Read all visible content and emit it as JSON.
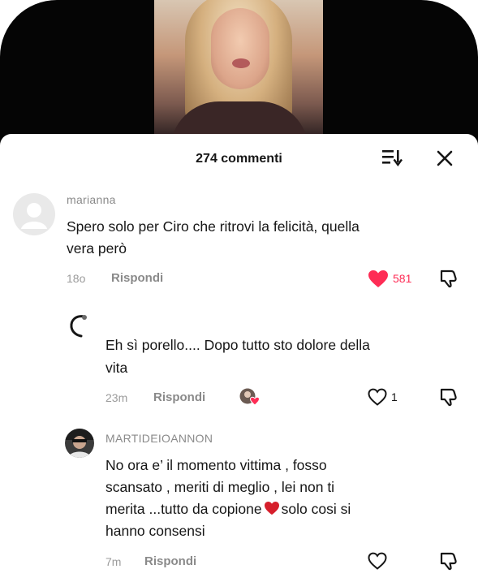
{
  "sheet": {
    "title": "274 commenti",
    "sort_icon": "sort-icon",
    "close_icon": "close-icon"
  },
  "comments": [
    {
      "username": "marianna",
      "text_line1": "Spero solo per Ciro che ritrovi la felicità, quella",
      "text_line2": "vera però",
      "time": "18o",
      "reply_label": "Rispondi",
      "likes": "581",
      "liked": true
    },
    {
      "username": "",
      "text_line1": "Eh sì porello.... Dopo tutto sto dolore della",
      "text_line2": "vita",
      "time": "23m",
      "reply_label": "Rispondi",
      "likes": "1",
      "liked": false
    },
    {
      "username": "MARTIDEIOANNON",
      "text_line1": "No ora e’ il momento vittima , fosso",
      "text_line2": "scansato , meriti di meglio , lei non ti",
      "text_line3a": "merita ...tutto da copione",
      "text_line3b": "solo cosi si",
      "text_line4": "hanno consensi",
      "time": "7m",
      "reply_label": "Rispondi",
      "likes": "",
      "liked": false
    }
  ],
  "colors": {
    "like_red": "#fe2c55",
    "text": "#161616",
    "muted": "#8a8a8a"
  }
}
